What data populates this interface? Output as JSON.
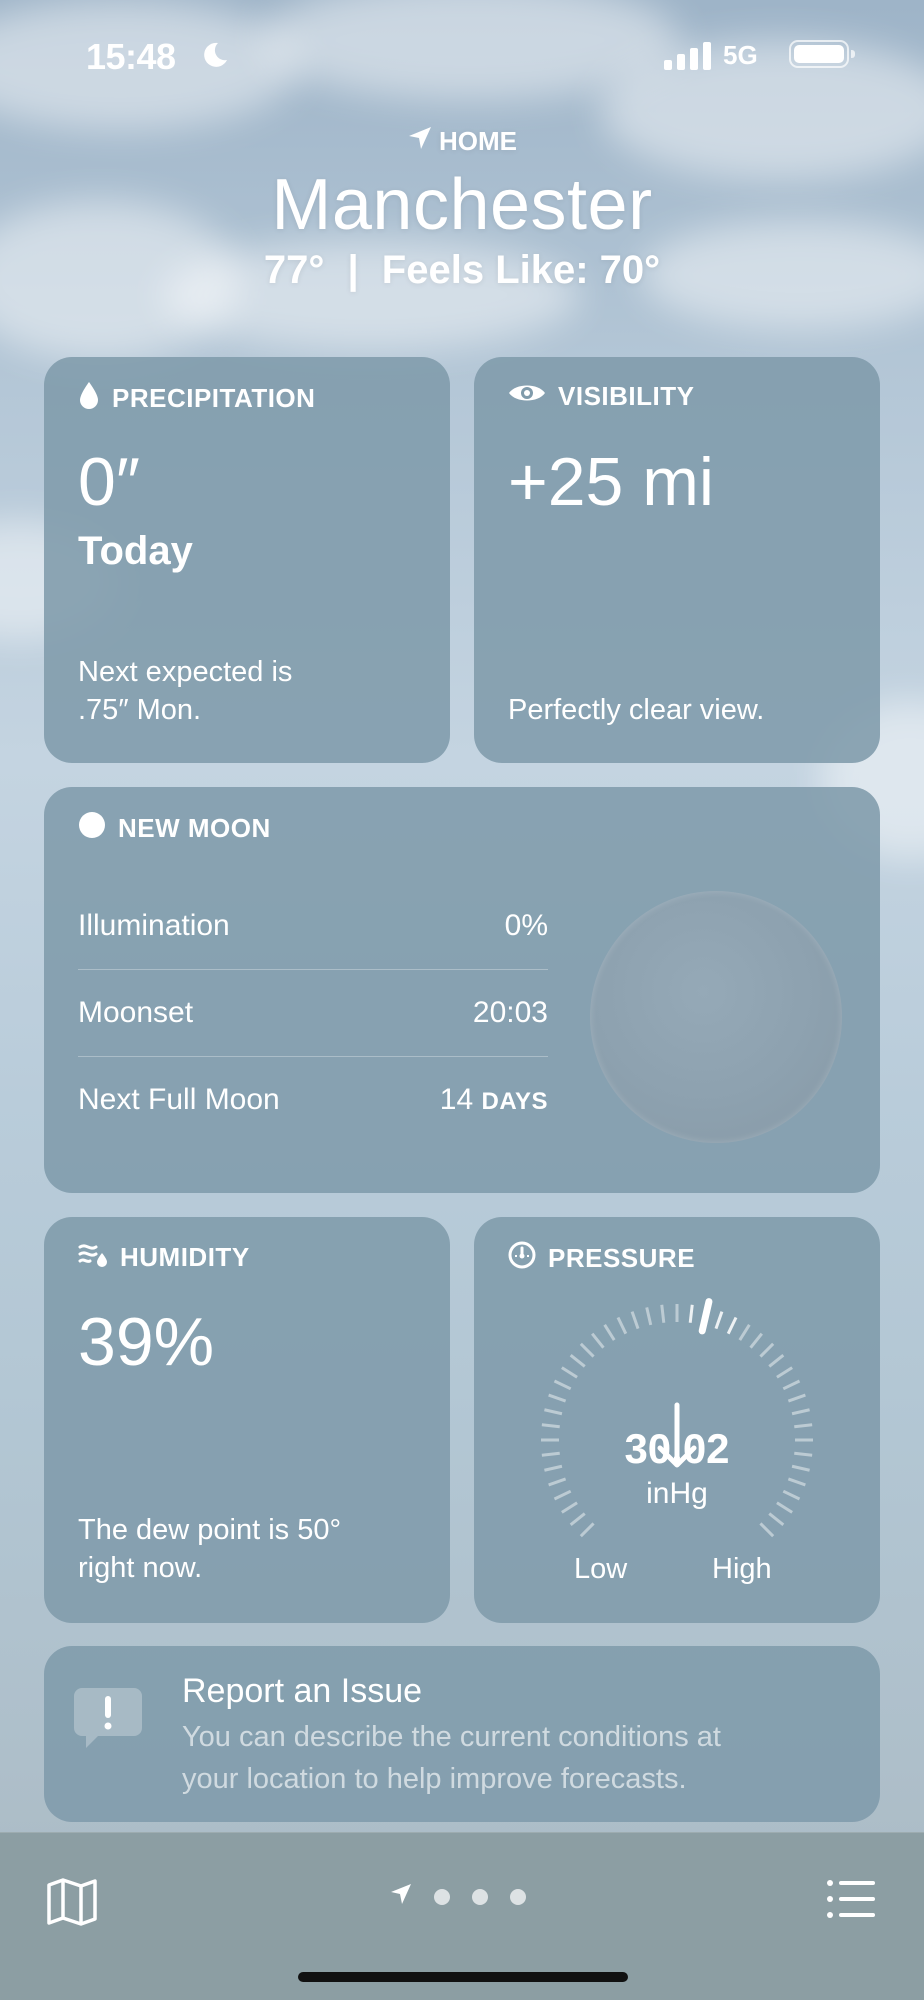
{
  "status_bar": {
    "time": "15:48",
    "network": "5G"
  },
  "header": {
    "location_label": "HOME",
    "city": "Manchester",
    "temperature": "77°",
    "separator": "|",
    "feels_like": "Feels Like: 70°"
  },
  "precipitation": {
    "title": "PRECIPITATION",
    "value": "0″",
    "period": "Today",
    "note_line1": "Next expected is",
    "note_line2": ".75″ Mon."
  },
  "visibility": {
    "title": "VISIBILITY",
    "value": "+25 mi",
    "note": "Perfectly clear view."
  },
  "moon": {
    "title": "NEW MOON",
    "rows": [
      {
        "label": "Illumination",
        "value": "0%"
      },
      {
        "label": "Moonset",
        "value": "20:03"
      },
      {
        "label": "Next Full Moon",
        "value_number": "14",
        "value_unit": "DAYS"
      }
    ]
  },
  "humidity": {
    "title": "HUMIDITY",
    "value": "39%",
    "note_line1": "The dew point is 50°",
    "note_line2": "right now."
  },
  "pressure": {
    "title": "PRESSURE",
    "value": "30.02",
    "unit": "inHg",
    "low_label": "Low",
    "high_label": "High",
    "trend": "falling"
  },
  "report": {
    "title": "Report an Issue",
    "description": "You can describe the current conditions at your location to help improve forecasts."
  },
  "bottom_bar": {
    "page_count": 4,
    "current_page": 1
  },
  "colors": {
    "card": "#809bab",
    "bottom_bar": "#8c9ea3"
  }
}
